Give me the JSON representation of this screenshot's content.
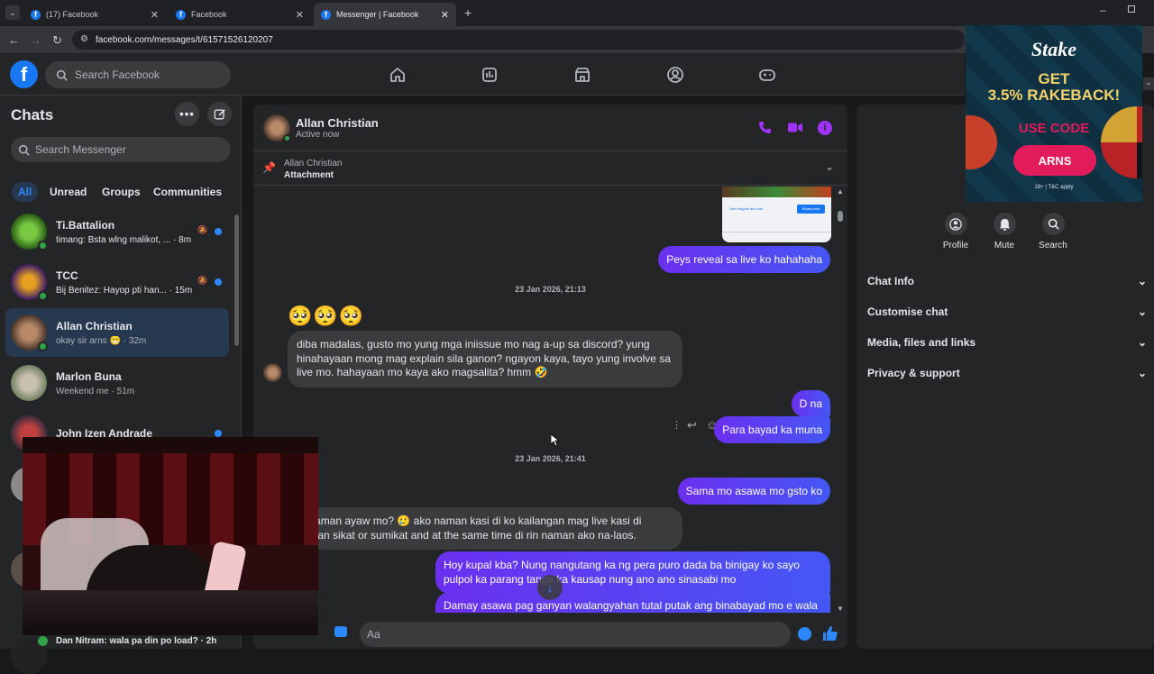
{
  "browser": {
    "tabs": [
      {
        "title": "(17) Facebook"
      },
      {
        "title": "Facebook"
      },
      {
        "title": "Messenger | Facebook"
      }
    ],
    "new_tab": "+",
    "url": "facebook.com/messages/t/61571526120207"
  },
  "header": {
    "logo": "f",
    "search_placeholder": "Search Facebook",
    "nav_icons": [
      "home-icon",
      "video-icon",
      "marketplace-icon",
      "groups-icon",
      "gaming-icon"
    ]
  },
  "sidebar": {
    "title": "Chats",
    "search_placeholder": "Search Messenger",
    "filters": [
      "All",
      "Unread",
      "Groups",
      "Communities"
    ],
    "chats": [
      {
        "name": "Ti.Battalion",
        "preview": "timang: Bsta wlng malikot, ...",
        "time": "8m"
      },
      {
        "name": "TCC",
        "preview": "Bij Benitez: Hayop pti han...",
        "time": "15m"
      },
      {
        "name": "Allan Christian",
        "preview": "okay sir arns 😁",
        "time": "32m"
      },
      {
        "name": "Marlon Buna",
        "preview": "Weekend me",
        "time": "51m"
      },
      {
        "name": "John Izen Andrade",
        "preview": "",
        "time": ""
      },
      {
        "name": "",
        "preview": "Dan Nitram: wala pa din po load?",
        "time": "2h"
      }
    ]
  },
  "conversation": {
    "contact_name": "Allan Christian",
    "status": "Active now",
    "pinned_sender": "Allan Christian",
    "pinned_label": "Attachment",
    "image_preview_text": "See insights and ads",
    "image_preview_button": "Boost post",
    "messages": {
      "m1": "Peys reveal sa live ko hahahaha",
      "ts1": "23 Jan 2026, 21:13",
      "emojis": "🥺🥺🥺",
      "m2": "diba madalas, gusto mo yung mga iniissue mo nag a-up sa discord? yung hinahayaan mong mag explain sila ganon? ngayon kaya, tayo yung involve sa live mo. hahayaan mo kaya ako magsalita? hmm 🤣",
      "m3": "D na",
      "m4": "Para bayad ka muna",
      "ts2": "23 Jan 2026, 21:41",
      "m5": "Sama mo asawa mo gsto ko",
      "m6": "at naman ayaw mo? 🥲 ako naman kasi di ko kailangan mag live kasi di naman sikat or sumikat and at the same time di rin naman ako na-laos.",
      "m7": "Hoy kupal kba? Nung nangutang ka ng pera puro dada ba binigay ko sayo pulpol ka parang tanga ka kausap nung ano ano sinasabi mo",
      "m8": "Damay asawa pag ganyan walangyahan tutal putak ang binabayad mo e wala akong"
    },
    "composer_placeholder": "Aa"
  },
  "details": {
    "actions": [
      {
        "label": "Profile"
      },
      {
        "label": "Mute"
      },
      {
        "label": "Search"
      }
    ],
    "sections": [
      "Chat Info",
      "Customise chat",
      "Media, files and links",
      "Privacy & support"
    ]
  },
  "ad": {
    "brand": "Stake",
    "line1": "GET",
    "line2": "3.5% RAKEBACK!",
    "line3": "USE CODE",
    "code": "ARNS",
    "footer": "18+ | T&C apply"
  },
  "colors": {
    "accent": "#2d88ff",
    "bubble_out": "#5b3af0",
    "bubble_in": "#3a3b3c",
    "panel": "#242526",
    "online": "#31a24c",
    "ad_code": "#e21b5a"
  }
}
